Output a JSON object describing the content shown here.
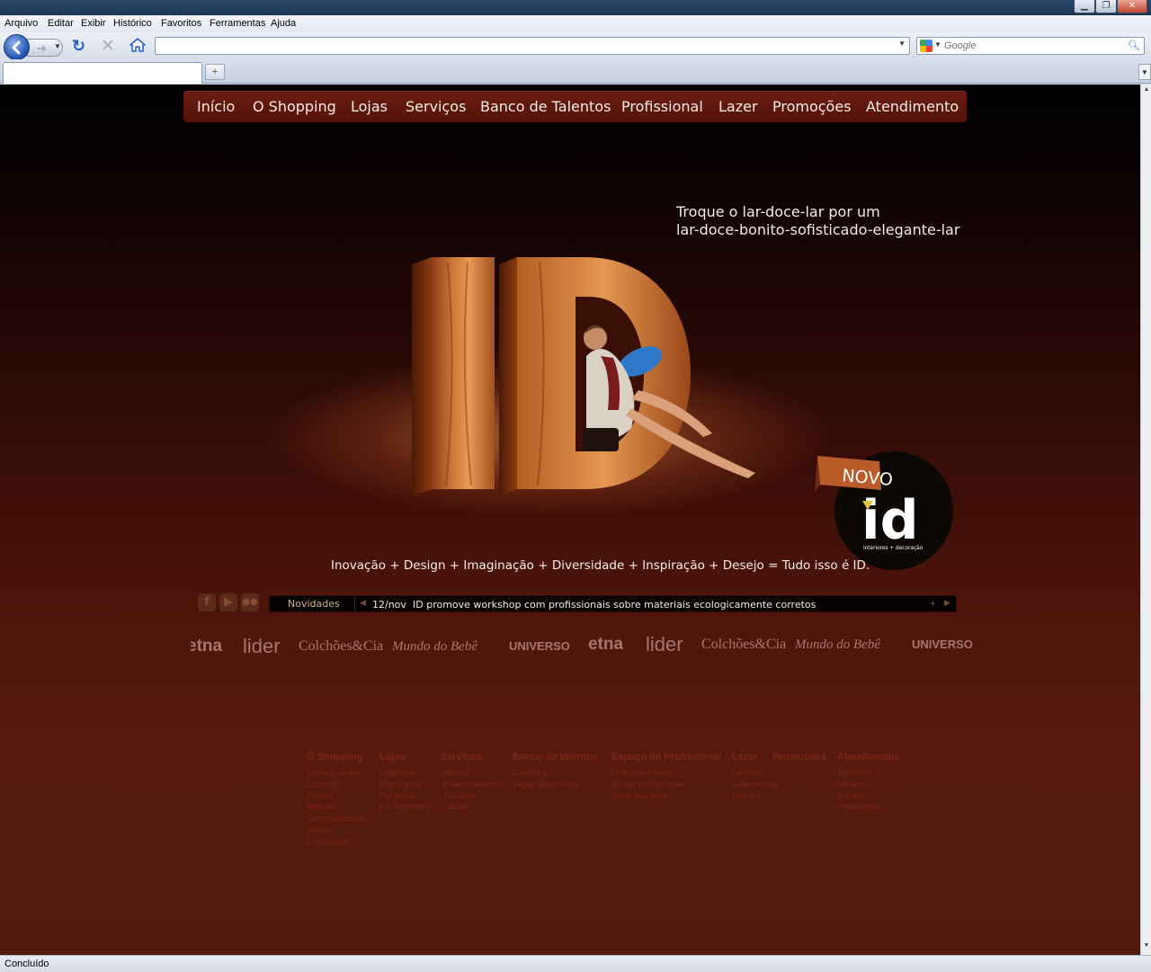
{
  "window": {
    "buttons": {
      "minimize": "▁",
      "maximize": "❐",
      "close": "✕"
    }
  },
  "menubar": {
    "items": [
      "Arquivo",
      "Editar",
      "Exibir",
      "Histórico",
      "Favoritos",
      "Ferramentas",
      "Ajuda"
    ]
  },
  "toolbar": {
    "url": "",
    "search_placeholder": "Google",
    "icons": [
      "back-icon",
      "forward-icon",
      "reload-icon",
      "stop-icon",
      "home-icon",
      "search-icon"
    ]
  },
  "tabs": {
    "new_tab": "+"
  },
  "site": {
    "nav": [
      "Início",
      "O Shopping",
      "Lojas",
      "Serviços",
      "Banco de Talentos",
      "Profissional",
      "Lazer",
      "Promoções",
      "Atendimento"
    ],
    "tagline": [
      "Troque o lar-doce-lar por um",
      "lar-doce-bonito-sofisticado-elegante-lar"
    ],
    "hero_letters": "ID",
    "badge": {
      "ribbon": "NOVO",
      "logo": "id",
      "caption": "interiores + decoração"
    },
    "slogan": "Inovação + Design + Imaginação + Diversidade + Inspiração + Desejo = Tudo isso é ID.",
    "social": [
      "facebook-icon",
      "youtube-icon",
      "flickr-icon"
    ],
    "ticker": {
      "label_pre": "Novi",
      "label_hl": "d",
      "label_post": "ades",
      "date": "12/nov",
      "text": "ID promove workshop com profissionais sobre materiais ecologicamente corretos",
      "prev": "◀",
      "next": "▶",
      "add": "+"
    },
    "brands": [
      "etna",
      "lider",
      "Colchões&Cia",
      "Mundo do Bebê",
      "UNIVERSO",
      "etna",
      "lider",
      "Colchões&Cia",
      "Mundo do Bebê",
      "UNIVERSO"
    ],
    "footer": [
      {
        "title": "O Shopping",
        "links": [
          "Sobre o Grupo",
          "Conceito",
          "Projeto",
          "Direção",
          "Comercialização",
          "Vídeo",
          "Localização"
        ]
      },
      {
        "title": "Lojas",
        "links": [
          "Empresas",
          "Busca geral",
          "Por andar",
          "Por segmento"
        ]
      },
      {
        "title": "Serviços",
        "links": [
          "Bancos",
          "Estacionamento",
          "Fraldário",
          "Caixas"
        ]
      },
      {
        "title": "Banco de talentos",
        "links": [
          "Cadastrar",
          "Vagas disponíveis"
        ]
      },
      {
        "title": "Espaço do Profissional",
        "links": [
          "Criar seu espaço",
          "Buscar profissionais",
          "Editar seu perfil"
        ]
      },
      {
        "title": "Lazer",
        "links": [
          "Cinemas",
          "Gastronomia",
          "Eventos"
        ]
      },
      {
        "title": "Promoções",
        "links": []
      },
      {
        "title": "Atendimento",
        "links": [
          "Telefones",
          "Horários",
          "E-mails",
          "Localização"
        ]
      }
    ]
  },
  "statusbar": {
    "text": "Concluído"
  },
  "colors": {
    "nav_bg": "#5e170c",
    "page_bg_bottom": "#521a0d",
    "footer_text": "#7a2414",
    "ticker_highlight": "#e7c04a"
  }
}
